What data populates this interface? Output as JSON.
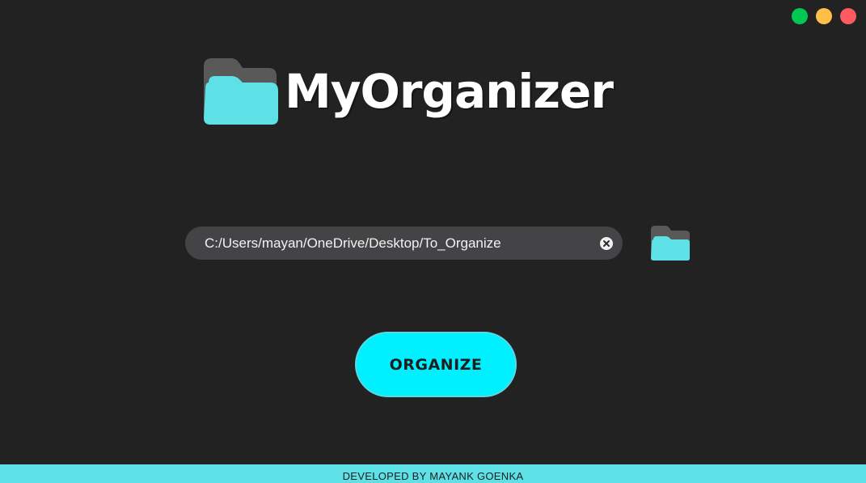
{
  "window": {
    "controls": [
      {
        "name": "maximize",
        "color": "#00c853"
      },
      {
        "name": "minimize",
        "color": "#ffbf47"
      },
      {
        "name": "close",
        "color": "#ff5a5f"
      }
    ]
  },
  "header": {
    "title": "MyOrganizer",
    "logo_icon": "folder-icon",
    "logo_colors": {
      "back": "#595959",
      "front": "#5ee1e6"
    }
  },
  "path_field": {
    "value": "C:/Users/mayan/OneDrive/Desktop/To_Organize",
    "clear_icon": "close-icon",
    "browse_icon": "folder-icon"
  },
  "action": {
    "organize_label": "ORGANIZE",
    "color": "#00f0ff"
  },
  "footer": {
    "text": "DEVELOPED BY MAYANK GOENKA",
    "color": "#5ee1e6"
  }
}
